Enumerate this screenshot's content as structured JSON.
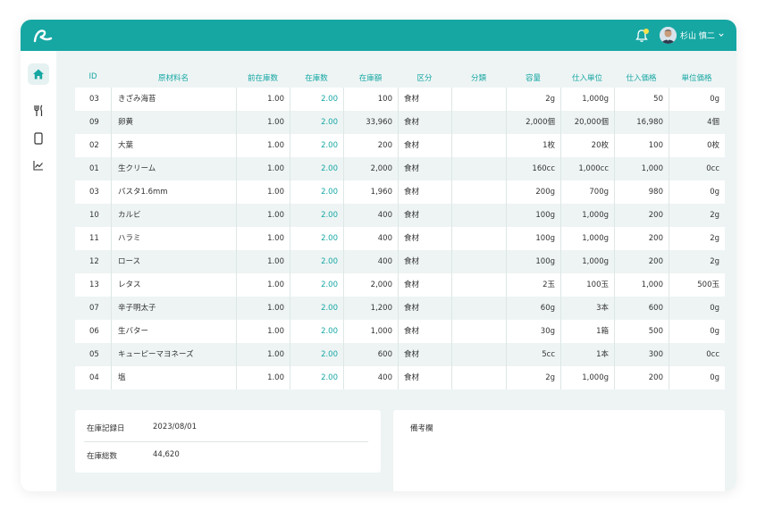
{
  "header": {
    "user_name": "杉山 慎二",
    "brand_color": "#16a7a3",
    "icons": [
      "logo-icon",
      "bell-icon",
      "avatar",
      "chevron-down-icon"
    ]
  },
  "sidebar": {
    "items": [
      {
        "name": "home",
        "icon": "home-icon",
        "active": true
      },
      {
        "name": "menu",
        "icon": "cutlery-icon",
        "active": false
      },
      {
        "name": "device",
        "icon": "phone-icon",
        "active": false
      },
      {
        "name": "analytics",
        "icon": "chart-icon",
        "active": false
      }
    ]
  },
  "table": {
    "headers": [
      "ID",
      "原材料名",
      "前在庫数",
      "在庫数",
      "在庫額",
      "区分",
      "分類",
      "容量",
      "仕入単位",
      "仕入価格",
      "単位価格"
    ],
    "rows": [
      {
        "id": "03",
        "name": "きざみ海苔",
        "prev": "1.00",
        "stock": "2.00",
        "amount": "100",
        "kubun": "食材",
        "bunrui": "",
        "capacity": "2g",
        "unit": "1,000g",
        "price": "50",
        "unit_price": "0g"
      },
      {
        "id": "09",
        "name": "卵黄",
        "prev": "1.00",
        "stock": "2.00",
        "amount": "33,960",
        "kubun": "食材",
        "bunrui": "",
        "capacity": "2,000個",
        "unit": "20,000個",
        "price": "16,980",
        "unit_price": "4個"
      },
      {
        "id": "02",
        "name": "大葉",
        "prev": "1.00",
        "stock": "2.00",
        "amount": "200",
        "kubun": "食材",
        "bunrui": "",
        "capacity": "1枚",
        "unit": "20枚",
        "price": "100",
        "unit_price": "0枚"
      },
      {
        "id": "01",
        "name": "生クリーム",
        "prev": "1.00",
        "stock": "2.00",
        "amount": "2,000",
        "kubun": "食材",
        "bunrui": "",
        "capacity": "160cc",
        "unit": "1,000cc",
        "price": "1,000",
        "unit_price": "0cc"
      },
      {
        "id": "03",
        "name": "パスタ1.6mm",
        "prev": "1.00",
        "stock": "2.00",
        "amount": "1,960",
        "kubun": "食材",
        "bunrui": "",
        "capacity": "200g",
        "unit": "700g",
        "price": "980",
        "unit_price": "0g"
      },
      {
        "id": "10",
        "name": "カルビ",
        "prev": "1.00",
        "stock": "2.00",
        "amount": "400",
        "kubun": "食材",
        "bunrui": "",
        "capacity": "100g",
        "unit": "1,000g",
        "price": "200",
        "unit_price": "2g"
      },
      {
        "id": "11",
        "name": "ハラミ",
        "prev": "1.00",
        "stock": "2.00",
        "amount": "400",
        "kubun": "食材",
        "bunrui": "",
        "capacity": "100g",
        "unit": "1,000g",
        "price": "200",
        "unit_price": "2g"
      },
      {
        "id": "12",
        "name": "ロース",
        "prev": "1.00",
        "stock": "2.00",
        "amount": "400",
        "kubun": "食材",
        "bunrui": "",
        "capacity": "100g",
        "unit": "1,000g",
        "price": "200",
        "unit_price": "2g"
      },
      {
        "id": "13",
        "name": "レタス",
        "prev": "1.00",
        "stock": "2.00",
        "amount": "2,000",
        "kubun": "食材",
        "bunrui": "",
        "capacity": "2玉",
        "unit": "100玉",
        "price": "1,000",
        "unit_price": "500玉"
      },
      {
        "id": "07",
        "name": "辛子明太子",
        "prev": "1.00",
        "stock": "2.00",
        "amount": "1,200",
        "kubun": "食材",
        "bunrui": "",
        "capacity": "60g",
        "unit": "3本",
        "price": "600",
        "unit_price": "0g"
      },
      {
        "id": "06",
        "name": "生バター",
        "prev": "1.00",
        "stock": "2.00",
        "amount": "1,000",
        "kubun": "食材",
        "bunrui": "",
        "capacity": "30g",
        "unit": "1箱",
        "price": "500",
        "unit_price": "0g"
      },
      {
        "id": "05",
        "name": "キューピーマヨネーズ",
        "prev": "1.00",
        "stock": "2.00",
        "amount": "600",
        "kubun": "食材",
        "bunrui": "",
        "capacity": "5cc",
        "unit": "1本",
        "price": "300",
        "unit_price": "0cc"
      },
      {
        "id": "04",
        "name": "塩",
        "prev": "1.00",
        "stock": "2.00",
        "amount": "400",
        "kubun": "食材",
        "bunrui": "",
        "capacity": "2g",
        "unit": "1,000g",
        "price": "200",
        "unit_price": "0g"
      }
    ]
  },
  "summary": {
    "date_label": "在庫記録日",
    "date_value": "2023/08/01",
    "total_label": "在庫総数",
    "total_value": "44,620"
  },
  "memo": {
    "label": "備考欄"
  }
}
